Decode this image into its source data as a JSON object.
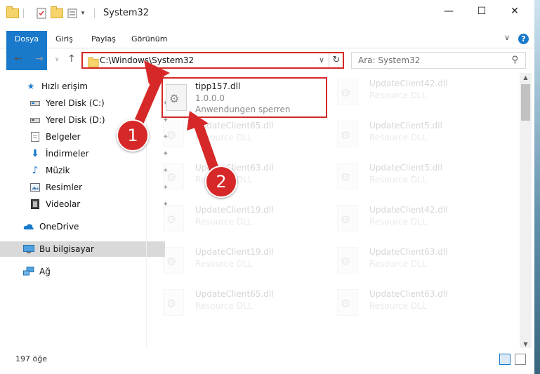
{
  "window": {
    "title": "System32",
    "minimize_glyph": "—",
    "maximize_glyph": "☐",
    "close_glyph": "✕"
  },
  "ribbon": {
    "tabs": [
      {
        "label": "Dosya"
      },
      {
        "label": "Giriş"
      },
      {
        "label": "Paylaş"
      },
      {
        "label": "Görünüm"
      }
    ],
    "help_label": "?"
  },
  "address": {
    "path": "C:\\Windows\\System32",
    "search_placeholder": "Ara: System32"
  },
  "sidebar": {
    "items": [
      {
        "label": "Hızlı erişim",
        "icon": "star-icon"
      },
      {
        "label": "Yerel Disk (C:)",
        "icon": "drive-icon"
      },
      {
        "label": "Yerel Disk (D:)",
        "icon": "drive-icon"
      },
      {
        "label": "Belgeler",
        "icon": "documents-icon"
      },
      {
        "label": "İndirmeler",
        "icon": "downloads-icon"
      },
      {
        "label": "Müzik",
        "icon": "music-icon"
      },
      {
        "label": "Resimler",
        "icon": "pictures-icon"
      },
      {
        "label": "Videolar",
        "icon": "videos-icon"
      },
      {
        "label": "OneDrive",
        "icon": "cloud-icon"
      },
      {
        "label": "Bu bilgisayar",
        "icon": "computer-icon"
      },
      {
        "label": "Ağ",
        "icon": "network-icon"
      }
    ]
  },
  "files": {
    "highlighted": {
      "name": "tipp157.dll",
      "version": "1.0.0.0",
      "description": "Anwendungen sperren"
    },
    "left_column": [
      {
        "name": "UpdateClient65.dll",
        "type": "Resource DLL"
      },
      {
        "name": "UpdateClient63.dll",
        "type": "Resource DLL"
      },
      {
        "name": "UpdateClient19.dll",
        "type": "Resource DLL"
      },
      {
        "name": "UpdateClient19.dll",
        "type": "Resource DLL"
      },
      {
        "name": "UpdateClient65.dll",
        "type": "Resource DLL"
      }
    ],
    "right_column": [
      {
        "name": "UpdateClient42.dll",
        "type": "Resource DLL"
      },
      {
        "name": "UpdateClient5.dll",
        "type": "Resource DLL"
      },
      {
        "name": "UpdateClient5.dll",
        "type": "Resource DLL"
      },
      {
        "name": "UpdateClient42.dll",
        "type": "Resource DLL"
      },
      {
        "name": "UpdateClient63.dll",
        "type": "Resource DLL"
      },
      {
        "name": "UpdateClient63.dll",
        "type": "Resource DLL"
      }
    ]
  },
  "status": {
    "item_count": "197 öğe"
  },
  "annotations": {
    "badge1": "1",
    "badge2": "2",
    "color": "#d62828"
  }
}
